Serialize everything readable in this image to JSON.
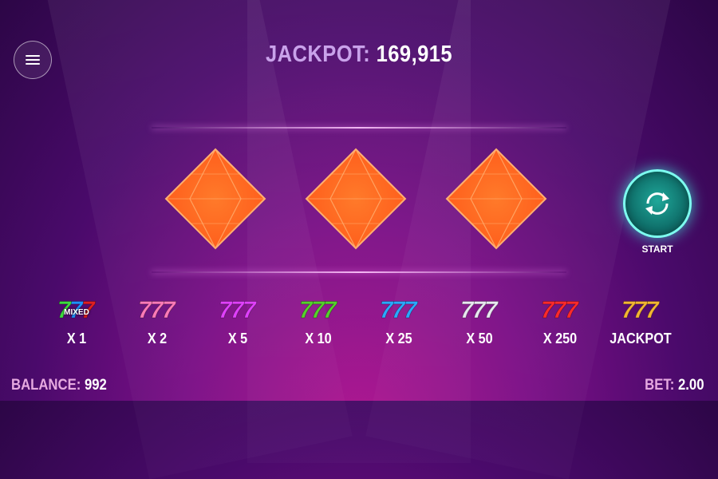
{
  "header": {
    "jackpot_label": "JACKPOT:",
    "jackpot_value": "169,915"
  },
  "menu": {
    "icon": "hamburger-menu-icon"
  },
  "reels": [
    {
      "symbol": "orange-diamond"
    },
    {
      "symbol": "orange-diamond"
    },
    {
      "symbol": "orange-diamond"
    }
  ],
  "start": {
    "label": "START",
    "icon": "spin-arrows-icon"
  },
  "paytable": [
    {
      "symbol": "mixed-sevens",
      "badge": "MIXED",
      "colors": [
        "#3ddc3d",
        "#1e90ff",
        "#e02020"
      ],
      "label": "X 1"
    },
    {
      "symbol": "pink-sevens",
      "colors": [
        "#ff7ab8",
        "#ff7ab8",
        "#ff7ab8"
      ],
      "label": "X 2"
    },
    {
      "symbol": "magenta-sevens",
      "colors": [
        "#e040fb",
        "#e040fb",
        "#e040fb"
      ],
      "label": "X 5"
    },
    {
      "symbol": "green-sevens",
      "colors": [
        "#55d12b",
        "#55d12b",
        "#55d12b"
      ],
      "label": "X 10"
    },
    {
      "symbol": "blue-sevens",
      "colors": [
        "#2ba8ff",
        "#2ba8ff",
        "#2ba8ff"
      ],
      "label": "X 25"
    },
    {
      "symbol": "white-sevens",
      "colors": [
        "#e8e8f0",
        "#e8e8f0",
        "#e8e8f0"
      ],
      "label": "X 50"
    },
    {
      "symbol": "red-sevens",
      "colors": [
        "#ff2a2a",
        "#ff2a2a",
        "#ff2a2a"
      ],
      "label": "X 250"
    },
    {
      "symbol": "gold-sevens",
      "colors": [
        "#f2b632",
        "#f2b632",
        "#f2b632"
      ],
      "label": "JACKPOT"
    }
  ],
  "footer": {
    "balance_label": "BALANCE:",
    "balance_value": "992",
    "bet_label": "BET:",
    "bet_value": "2.00"
  },
  "colors": {
    "diamond": "#ff5a1a",
    "start_ring": "#7dfff0",
    "jackpot_label": "#c9a2ea"
  }
}
